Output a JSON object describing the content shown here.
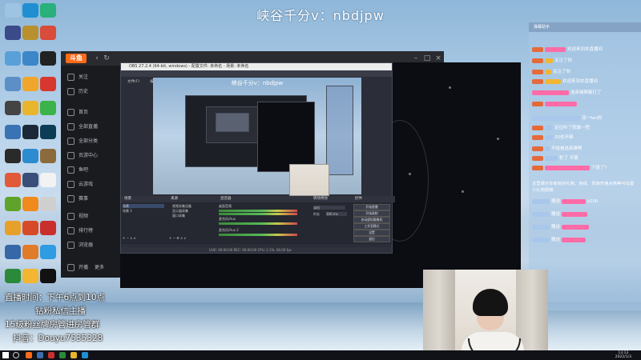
{
  "overlay": {
    "watermark": "峡谷千分v：nbdjpw",
    "schedule_line": "直播时间：下午6点到10点",
    "dm_line": "钻粉私信主播",
    "group_line": "15级粉丝牌房管进房管群",
    "douyin_line": "抖音：Douyu7535328"
  },
  "app": {
    "logo": "斗鱼",
    "nav": [
      {
        "label": "关注"
      },
      {
        "label": "历史"
      },
      {
        "label": "首页"
      },
      {
        "label": "全部直播"
      },
      {
        "label": "全部分类"
      },
      {
        "label": "页游中心"
      },
      {
        "label": "鱼吧"
      },
      {
        "label": "云游戏"
      },
      {
        "label": "赛事"
      },
      {
        "label": "视频"
      },
      {
        "label": "排行榜"
      },
      {
        "label": "浏览器"
      }
    ],
    "bottom_start": "开播",
    "bottom_more": "更多"
  },
  "obs": {
    "title": "OBS 27.2.4 (64-bit, windows) - 配置文件: 未命名 - 场景: 未命名",
    "menu": [
      "文件(F)",
      "编辑(E)",
      "视图(V)",
      "停靠部件(D)",
      "配置文件(P)",
      "场景集合(S)",
      "工具(T)",
      "帮助(H)"
    ],
    "preview_watermark": "峡谷千分v：nbdjpw",
    "docks": {
      "scenes": "场景",
      "sources": "来源",
      "mixer": "混音器",
      "transitions": "转场特效",
      "controls": "控件"
    },
    "scene_items": [
      "场景",
      "场景 2"
    ],
    "source_items": [
      "视频采集设备",
      "显示器采集",
      "窗口采集"
    ],
    "mixer_items": [
      "桌面音频",
      "麦克风/Aux",
      "麦克风/Aux 2"
    ],
    "transition_value": "淡出",
    "duration_label": "时长",
    "duration_value": "300 ms",
    "control_buttons": [
      "开始直播",
      "开始录制",
      "启动虚拟摄像机",
      "工作室模式",
      "设置",
      "退出"
    ],
    "status": "LIVE: 00:00:00   REC: 00:00:00   CPU: 2.1%, 60.00 fps"
  },
  "chat": {
    "header": "弹幕助手",
    "messages": [
      {
        "name": "用户",
        "text": "欢迎来到本直播间",
        "warm": false
      },
      {
        "name": "",
        "text": "关注了你",
        "warm": false
      },
      {
        "name": "",
        "text": "关注了你",
        "warm": false
      },
      {
        "name": "",
        "text": "欢迎来到本直播间",
        "warm": false
      },
      {
        "name": "",
        "text": "选英雄屏蔽打了",
        "warm": false
      },
      {
        "name": "",
        "text": "",
        "warm": false
      },
      {
        "name": "",
        "text": "双一fan的",
        "warm": false
      },
      {
        "name": "",
        "text": "定位听了就输一把",
        "warm": false
      },
      {
        "name": "",
        "text": "20也不够",
        "warm": false
      },
      {
        "name": "",
        "text": "不给看选英雄啊",
        "warm": false
      },
      {
        "name": "",
        "text": "秒了 不算",
        "warm": false
      },
      {
        "name": "",
        "text": "下班了?",
        "warm": false
      }
    ],
    "system_notice": "这里展示你收到的礼物、连线、贵族开通点亮等可设置小礼物屏蔽",
    "gift_lines": [
      {
        "action": "赠送",
        "item": "x100"
      },
      {
        "action": "赠送",
        "item": ""
      },
      {
        "action": "赠送",
        "item": ""
      },
      {
        "action": "赠送",
        "item": ""
      }
    ]
  },
  "taskbar": {
    "time": "13:13",
    "date": "2022/1/3"
  }
}
